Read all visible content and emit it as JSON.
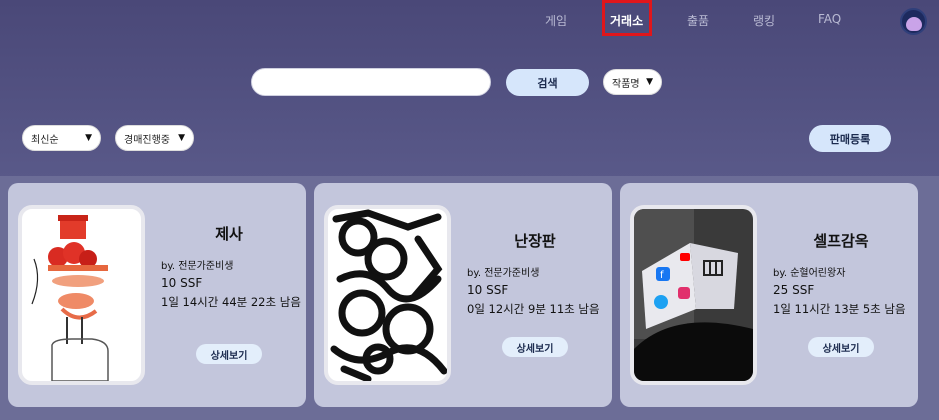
{
  "nav": {
    "items": [
      "게임",
      "거래소",
      "출품",
      "랭킹",
      "FAQ"
    ],
    "active": "거래소"
  },
  "search": {
    "value": "",
    "button_label": "검색",
    "type_select": "작품명"
  },
  "filters": {
    "sort": "최신순",
    "status": "경매진행중"
  },
  "sell_button": "판매등록",
  "cards": [
    {
      "title": "제사",
      "by": "by. 전문가준비생",
      "price": "10 SSF",
      "time": "1일 14시간 44분 22초 남음",
      "detail": "상세보기",
      "art": "drawing-red-tower"
    },
    {
      "title": "난장판",
      "by": "by. 전문가준비생",
      "price": "10 SSF",
      "time": "0일 12시간 9분 11초 남음",
      "detail": "상세보기",
      "art": "drawing-black-scribble"
    },
    {
      "title": "셀프감옥",
      "by": "by. 순혈어린왕자",
      "price": "25 SSF",
      "time": "1일 11시간 13분 5초 남음",
      "detail": "상세보기",
      "art": "drawing-social-cube"
    }
  ],
  "colors": {
    "accent_button": "#d6e6fb",
    "active_highlight": "#e0161b",
    "card_bg": "#c3c6dc"
  }
}
